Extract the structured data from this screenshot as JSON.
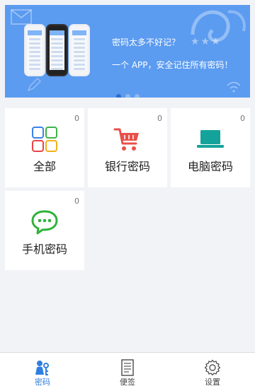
{
  "banner": {
    "line1": "密码太多不好记？",
    "line2": "一个 APP，安全记住所有密码！",
    "slide_count": 3,
    "active_slide": 1,
    "color": "#5b9bf0"
  },
  "categories": [
    {
      "label": "全部",
      "count": "0",
      "icon": "grid-icon"
    },
    {
      "label": "银行密码",
      "count": "0",
      "icon": "cart-icon"
    },
    {
      "label": "电脑密码",
      "count": "0",
      "icon": "laptop-icon"
    },
    {
      "label": "手机密码",
      "count": "0",
      "icon": "chat-bubble-icon"
    }
  ],
  "tabbar": {
    "items": [
      {
        "label": "密码",
        "icon": "key-person-icon",
        "active": true
      },
      {
        "label": "便签",
        "icon": "note-icon",
        "active": false
      },
      {
        "label": "设置",
        "icon": "gear-icon",
        "active": false
      }
    ],
    "active_color": "#2f7fe0"
  }
}
